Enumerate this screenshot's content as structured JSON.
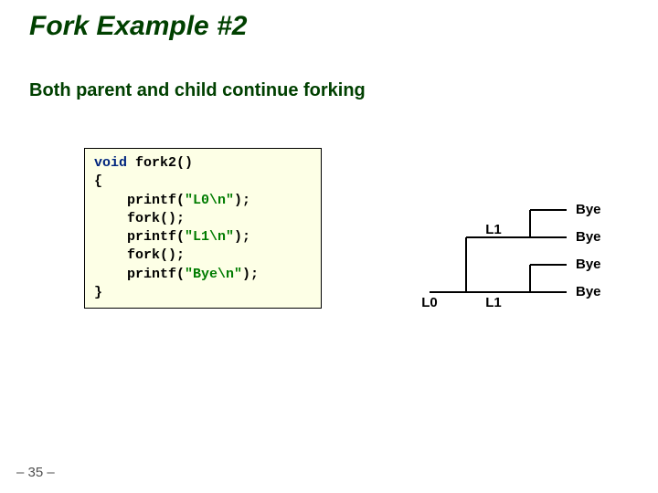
{
  "title": "Fork Example #2",
  "subtitle": "Both parent and child continue forking",
  "code": {
    "l1a": "void",
    "l1b": " fork2()",
    "l2": "{",
    "l3a": "    printf(",
    "l3b": "\"L0\\n\"",
    "l3c": ");",
    "l4": "    fork();",
    "l5a": "    printf(",
    "l5b": "\"L1\\n\"",
    "l5c": ");",
    "l6": "    fork();",
    "l7a": "    printf(",
    "l7b": "\"Bye\\n\"",
    "l7c": ");",
    "l8": "}"
  },
  "labels": {
    "L0": "L0",
    "L1": "L1",
    "Bye": "Bye"
  },
  "slidenum": "– 35 –"
}
